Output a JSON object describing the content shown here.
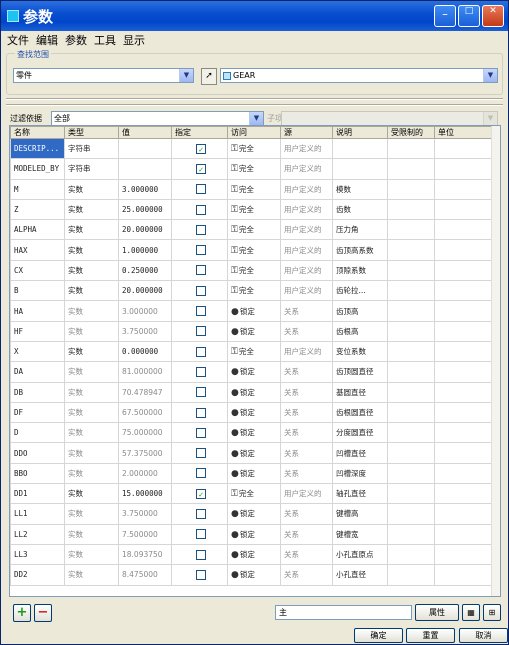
{
  "window": {
    "title": "参数"
  },
  "menu": [
    "文件",
    "编辑",
    "参数",
    "工具",
    "显示"
  ],
  "lookin": {
    "group_label": "查找范围",
    "scope_value": "零件",
    "model_value": "GEAR"
  },
  "filter": {
    "label": "过滤依据",
    "value": "全部",
    "sub_label": "子项"
  },
  "table": {
    "columns": [
      "名称",
      "类型",
      "值",
      "指定",
      "访问",
      "源",
      "说明",
      "受限制的",
      "单位"
    ],
    "rows": [
      {
        "name": "DESCRIP...",
        "type": "字符串",
        "value": "",
        "designated": true,
        "access": "完全",
        "source": "用户定义的",
        "desc": ""
      },
      {
        "name": "MODELED_BY",
        "type": "字符串",
        "value": "",
        "designated": true,
        "access": "完全",
        "source": "用户定义的",
        "desc": ""
      },
      {
        "name": "M",
        "type": "实数",
        "value": "3.000000",
        "designated": false,
        "access": "完全",
        "source": "用户定义的",
        "desc": "模数"
      },
      {
        "name": "Z",
        "type": "实数",
        "value": "25.000000",
        "designated": false,
        "access": "完全",
        "source": "用户定义的",
        "desc": "齿数"
      },
      {
        "name": "ALPHA",
        "type": "实数",
        "value": "20.000000",
        "designated": false,
        "access": "完全",
        "source": "用户定义的",
        "desc": "压力角"
      },
      {
        "name": "HAX",
        "type": "实数",
        "value": "1.000000",
        "designated": false,
        "access": "完全",
        "source": "用户定义的",
        "desc": "齿顶高系数"
      },
      {
        "name": "CX",
        "type": "实数",
        "value": "0.250000",
        "designated": false,
        "access": "完全",
        "source": "用户定义的",
        "desc": "顶隙系数"
      },
      {
        "name": "B",
        "type": "实数",
        "value": "20.000000",
        "designated": false,
        "access": "完全",
        "source": "用户定义的",
        "desc": "齿轮拉..."
      },
      {
        "name": "HA",
        "type": "实数",
        "value": "3.000000",
        "designated": false,
        "access": "锁定",
        "source": "关系",
        "desc": "齿顶高"
      },
      {
        "name": "HF",
        "type": "实数",
        "value": "3.750000",
        "designated": false,
        "access": "锁定",
        "source": "关系",
        "desc": "齿根高"
      },
      {
        "name": "X",
        "type": "实数",
        "value": "0.000000",
        "designated": false,
        "access": "完全",
        "source": "用户定义的",
        "desc": "变位系数"
      },
      {
        "name": "DA",
        "type": "实数",
        "value": "81.000000",
        "designated": false,
        "access": "锁定",
        "source": "关系",
        "desc": "齿顶圆直径"
      },
      {
        "name": "DB",
        "type": "实数",
        "value": "70.478947",
        "designated": false,
        "access": "锁定",
        "source": "关系",
        "desc": "基圆直径"
      },
      {
        "name": "DF",
        "type": "实数",
        "value": "67.500000",
        "designated": false,
        "access": "锁定",
        "source": "关系",
        "desc": "齿根圆直径"
      },
      {
        "name": "D",
        "type": "实数",
        "value": "75.000000",
        "designated": false,
        "access": "锁定",
        "source": "关系",
        "desc": "分度圆直径"
      },
      {
        "name": "DDO",
        "type": "实数",
        "value": "57.375000",
        "designated": false,
        "access": "锁定",
        "source": "关系",
        "desc": "凹槽直径"
      },
      {
        "name": "BBO",
        "type": "实数",
        "value": "2.000000",
        "designated": false,
        "access": "锁定",
        "source": "关系",
        "desc": "凹槽深度"
      },
      {
        "name": "DD1",
        "type": "实数",
        "value": "15.000000",
        "designated": true,
        "access": "完全",
        "source": "用户定义的",
        "desc": "轴孔直径"
      },
      {
        "name": "LL1",
        "type": "实数",
        "value": "3.750000",
        "designated": false,
        "access": "锁定",
        "source": "关系",
        "desc": "键槽高"
      },
      {
        "name": "LL2",
        "type": "实数",
        "value": "7.500000",
        "designated": false,
        "access": "锁定",
        "source": "关系",
        "desc": "键槽宽"
      },
      {
        "name": "LL3",
        "type": "实数",
        "value": "18.093750",
        "designated": false,
        "access": "锁定",
        "source": "关系",
        "desc": "小孔直原点"
      },
      {
        "name": "DD2",
        "type": "实数",
        "value": "8.475000",
        "designated": false,
        "access": "锁定",
        "source": "关系",
        "desc": "小孔直径"
      }
    ]
  },
  "bottom": {
    "search_value": "主",
    "props_button": "属性",
    "ok": "确定",
    "reset": "重置",
    "cancel": "取消"
  },
  "colors": {
    "titlebar": "#0046c8",
    "selected_cell": "#316ac5"
  }
}
